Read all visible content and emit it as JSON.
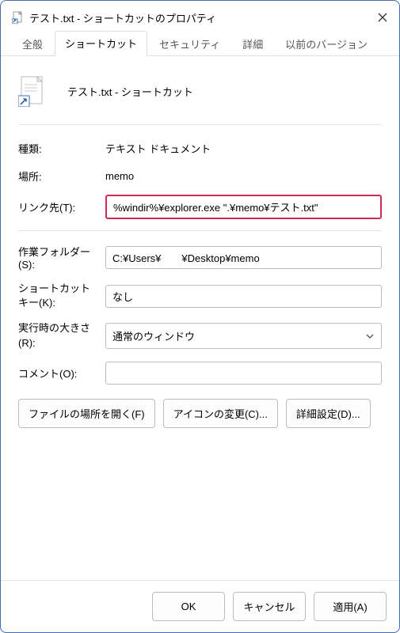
{
  "window": {
    "title": "テスト.txt - ショートカットのプロパティ"
  },
  "tabs": {
    "general": "全般",
    "shortcut": "ショートカット",
    "security": "セキュリティ",
    "details": "詳細",
    "previous": "以前のバージョン"
  },
  "header": {
    "filename": "テスト.txt - ショートカット"
  },
  "fields": {
    "type_label": "種類:",
    "type_value": "テキスト ドキュメント",
    "location_label": "場所:",
    "location_value": "memo",
    "target_label": "リンク先(T):",
    "target_value": "%windir%¥explorer.exe \".¥memo¥テスト.txt\"",
    "startin_label": "作業フォルダー(S):",
    "startin_value": "C:¥Users¥　　¥Desktop¥memo",
    "shortcutkey_label": "ショートカット キー(K):",
    "shortcutkey_value": "なし",
    "run_label": "実行時の大きさ(R):",
    "run_value": "通常のウィンドウ",
    "comment_label": "コメント(O):",
    "comment_value": ""
  },
  "buttons": {
    "open_location": "ファイルの場所を開く(F)",
    "change_icon": "アイコンの変更(C)...",
    "advanced": "詳細設定(D)..."
  },
  "footer": {
    "ok": "OK",
    "cancel": "キャンセル",
    "apply": "適用(A)"
  }
}
